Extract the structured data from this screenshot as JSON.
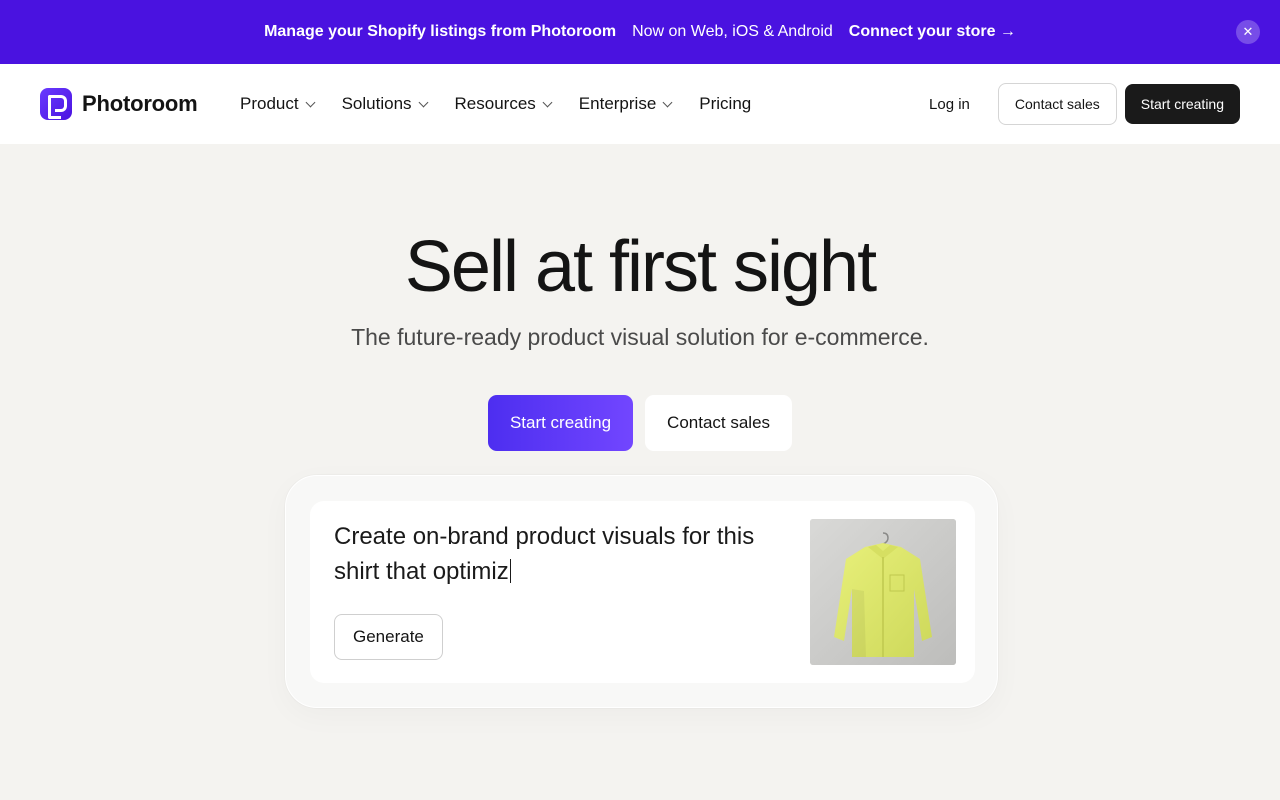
{
  "banner": {
    "text_bold": "Manage your Shopify listings from Photoroom",
    "text_regular": "Now on Web, iOS & Android",
    "link_label": "Connect your store →",
    "close_icon": "close-icon",
    "background": "#4a12e0"
  },
  "header": {
    "logo_text": "Photoroom",
    "nav": [
      {
        "label": "Product",
        "has_dropdown": true
      },
      {
        "label": "Solutions",
        "has_dropdown": true
      },
      {
        "label": "Resources",
        "has_dropdown": true
      },
      {
        "label": "Enterprise",
        "has_dropdown": true
      },
      {
        "label": "Pricing",
        "has_dropdown": false
      }
    ],
    "login_label": "Log in",
    "contact_sales_label": "Contact sales",
    "start_creating_label": "Start creating"
  },
  "hero": {
    "title": "Sell at first sight",
    "subtitle": "The future-ready product visual solution for e-commerce.",
    "primary_cta": "Start creating",
    "secondary_cta": "Contact sales",
    "accent": "#5a35f5"
  },
  "prompt_card": {
    "prompt_text": "Create on-brand product visuals for this shirt that optimiz",
    "generate_label": "Generate",
    "image_subject": "yellow shirt on hanger"
  }
}
